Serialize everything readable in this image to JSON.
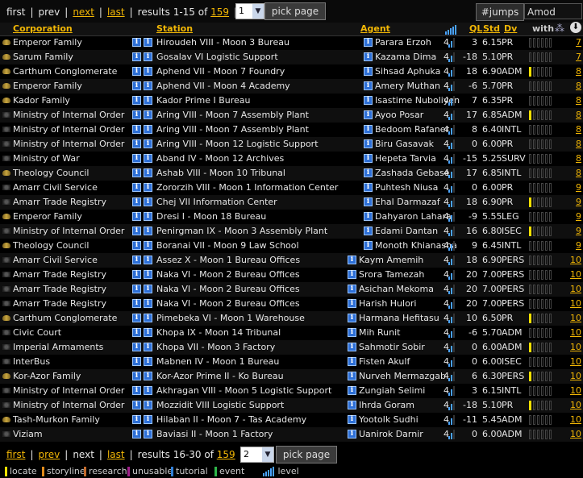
{
  "nav_top": {
    "first": "first",
    "prev": "prev",
    "next": "next",
    "last": "last",
    "results_prefix": "results 1-15 of",
    "total": "159",
    "page_value": "1",
    "pick_label": "pick page",
    "jumps_label": "#jumps",
    "search_value": "Amod"
  },
  "header": {
    "corporation": "Corporation",
    "station": "Station",
    "agent": "Agent",
    "ql": "QL",
    "std": "Std",
    "div": "Dv",
    "with": "with"
  },
  "rows": [
    {
      "corp": "Emperor Family",
      "station": "Hiroudeh VIII - Moon 3 Bureau",
      "agent": "Parara Erzoh",
      "level": "4",
      "ql": "3",
      "std": "6.15",
      "div": "PR",
      "jumps": "7",
      "with": 0
    },
    {
      "corp": "Sarum Family",
      "station": "Gosalav VI Logistic Support",
      "agent": "Kazama Dima",
      "level": "4",
      "ql": "-18",
      "std": "5.10",
      "div": "PR",
      "jumps": "7",
      "with": 0
    },
    {
      "corp": "Carthum Conglomerate",
      "station": "Aphend VII - Moon 7 Foundry",
      "agent": "Sihsad Aphuka",
      "level": "4",
      "ql": "18",
      "std": "6.90",
      "div": "ADM",
      "jumps": "8",
      "with": 1
    },
    {
      "corp": "Emperor Family",
      "station": "Aphend VII - Moon 4 Academy",
      "agent": "Amery Muthan",
      "level": "4",
      "ql": "-6",
      "std": "5.70",
      "div": "PR",
      "jumps": "8",
      "with": 0
    },
    {
      "corp": "Kador Family",
      "station": "Kador Prime I Bureau",
      "agent": "Isastime Nuboliyen",
      "level": "4",
      "ql": "7",
      "std": "6.35",
      "div": "PR",
      "jumps": "8",
      "with": 0
    },
    {
      "corp": "Ministry of Internal Order",
      "station": "Aring VIII - Moon 7 Assembly Plant",
      "agent": "Ayoo Posar",
      "level": "4",
      "ql": "17",
      "std": "6.85",
      "div": "ADM",
      "jumps": "8",
      "with": 1
    },
    {
      "corp": "Ministry of Internal Order",
      "station": "Aring VIII - Moon 7 Assembly Plant",
      "agent": "Bedoom Rafaner",
      "level": "4",
      "ql": "8",
      "std": "6.40",
      "div": "INTL",
      "jumps": "8",
      "with": 0
    },
    {
      "corp": "Ministry of Internal Order",
      "station": "Aring VIII - Moon 12 Logistic Support",
      "agent": "Biru Gasavak",
      "level": "4",
      "ql": "0",
      "std": "6.00",
      "div": "PR",
      "jumps": "8",
      "with": 0
    },
    {
      "corp": "Ministry of War",
      "station": "Aband IV - Moon 12 Archives",
      "agent": "Hepeta Tarvia",
      "level": "4",
      "ql": "-15",
      "std": "5.25",
      "div": "SURV",
      "jumps": "8",
      "with": 0
    },
    {
      "corp": "Theology Council",
      "station": "Ashab VIII - Moon 10 Tribunal",
      "agent": "Zashada Gebase",
      "level": "4",
      "ql": "17",
      "std": "6.85",
      "div": "INTL",
      "jumps": "8",
      "with": 0
    },
    {
      "corp": "Amarr Civil Service",
      "station": "Zororzih VIII - Moon 1 Information Center",
      "agent": "Puhtesh Niusa",
      "level": "4",
      "ql": "0",
      "std": "6.00",
      "div": "PR",
      "jumps": "9",
      "with": 0
    },
    {
      "corp": "Amarr Trade Registry",
      "station": "Chej VII Information Center",
      "agent": "Ehal Darmazaf",
      "level": "4",
      "ql": "18",
      "std": "6.90",
      "div": "PR",
      "jumps": "9",
      "with": 1
    },
    {
      "corp": "Emperor Family",
      "station": "Dresi I - Moon 18 Bureau",
      "agent": "Dahyaron Lahara",
      "level": "4",
      "ql": "-9",
      "std": "5.55",
      "div": "LEG",
      "jumps": "9",
      "with": 0
    },
    {
      "corp": "Ministry of Internal Order",
      "station": "Penirgman IX - Moon 3 Assembly Plant",
      "agent": "Edami Dantan",
      "level": "4",
      "ql": "16",
      "std": "6.80",
      "div": "ISEC",
      "jumps": "9",
      "with": 1
    },
    {
      "corp": "Theology Council",
      "station": "Boranai VII - Moon 9 Law School",
      "agent": "Monoth Khianasha",
      "level": "4",
      "ql": "9",
      "std": "6.45",
      "div": "INTL",
      "jumps": "9",
      "with": 0
    },
    {
      "corp": "Amarr Civil Service",
      "station": "Assez X - Moon 1 Bureau Offices",
      "agent": "Kaym Amemih",
      "level": "4",
      "ql": "18",
      "std": "6.90",
      "div": "PERS",
      "jumps": "10",
      "with": 0
    },
    {
      "corp": "Amarr Trade Registry",
      "station": "Naka VI - Moon 2 Bureau Offices",
      "agent": "Srora Tamezah",
      "level": "4",
      "ql": "20",
      "std": "7.00",
      "div": "PERS",
      "jumps": "10",
      "with": 0
    },
    {
      "corp": "Amarr Trade Registry",
      "station": "Naka VI - Moon 2 Bureau Offices",
      "agent": "Asichan Mekoma",
      "level": "4",
      "ql": "20",
      "std": "7.00",
      "div": "PERS",
      "jumps": "10",
      "with": 0
    },
    {
      "corp": "Amarr Trade Registry",
      "station": "Naka VI - Moon 2 Bureau Offices",
      "agent": "Harish Hulori",
      "level": "4",
      "ql": "20",
      "std": "7.00",
      "div": "PERS",
      "jumps": "10",
      "with": 0
    },
    {
      "corp": "Carthum Conglomerate",
      "station": "Pimebeka VI - Moon 1 Warehouse",
      "agent": "Harmana Hefitasu",
      "level": "4",
      "ql": "10",
      "std": "6.50",
      "div": "PR",
      "jumps": "10",
      "with": 1
    },
    {
      "corp": "Civic Court",
      "station": "Khopa IX - Moon 14 Tribunal",
      "agent": "Mih Runit",
      "level": "4",
      "ql": "-6",
      "std": "5.70",
      "div": "ADM",
      "jumps": "10",
      "with": 0
    },
    {
      "corp": "Imperial Armaments",
      "station": "Khopa VII - Moon 3 Factory",
      "agent": "Sahmotir Sobir",
      "level": "4",
      "ql": "0",
      "std": "6.00",
      "div": "ADM",
      "jumps": "10",
      "with": 1
    },
    {
      "corp": "InterBus",
      "station": "Mabnen IV - Moon 1 Bureau",
      "agent": "Fisten Akulf",
      "level": "4",
      "ql": "0",
      "std": "6.00",
      "div": "ISEC",
      "jumps": "10",
      "with": 0
    },
    {
      "corp": "Kor-Azor Family",
      "station": "Kor-Azor Prime II - Ko Bureau",
      "agent": "Nurveh Mermazgab",
      "level": "4",
      "ql": "6",
      "std": "6.30",
      "div": "PERS",
      "jumps": "10",
      "with": 1
    },
    {
      "corp": "Ministry of Internal Order",
      "station": "Akhragan VIII - Moon 5 Logistic Support",
      "agent": "Zungiah Selimi",
      "level": "4",
      "ql": "3",
      "std": "6.15",
      "div": "INTL",
      "jumps": "10",
      "with": 0
    },
    {
      "corp": "Ministry of Internal Order",
      "station": "Mozzidit VIII Logistic Support",
      "agent": "Ihrda Goram",
      "level": "4",
      "ql": "-18",
      "std": "5.10",
      "div": "PR",
      "jumps": "10",
      "with": 1
    },
    {
      "corp": "Tash-Murkon Family",
      "station": "Hilaban II - Moon 7 - Tas Academy",
      "agent": "Yootolk Sudhi",
      "level": "4",
      "ql": "-11",
      "std": "5.45",
      "div": "ADM",
      "jumps": "10",
      "with": 0
    },
    {
      "corp": "Viziam",
      "station": "Baviasi II - Moon 1 Factory",
      "agent": "Uanirok Darnir",
      "level": "4",
      "ql": "0",
      "std": "6.00",
      "div": "ADM",
      "jumps": "10",
      "with": 0
    }
  ],
  "nav_bottom": {
    "first": "first",
    "prev": "prev",
    "next": "next",
    "last": "last",
    "results_prefix": "results 16-30 of",
    "total": "159",
    "page_value": "2",
    "pick_label": "pick page"
  },
  "legend": [
    {
      "label": "locate",
      "color": "#f2e000"
    },
    {
      "label": "storyline",
      "color": "#e08a1a"
    },
    {
      "label": "research",
      "color": "#c46a2a"
    },
    {
      "label": "unusable",
      "color": "#a0208a"
    },
    {
      "label": "tutorial",
      "color": "#2f7fd8"
    },
    {
      "label": "event",
      "color": "#2fb84a"
    }
  ],
  "legend_level": "level",
  "colors": {
    "link": "#f2b705",
    "info": "#2d6fd6",
    "bar": "#4aa3ff"
  }
}
